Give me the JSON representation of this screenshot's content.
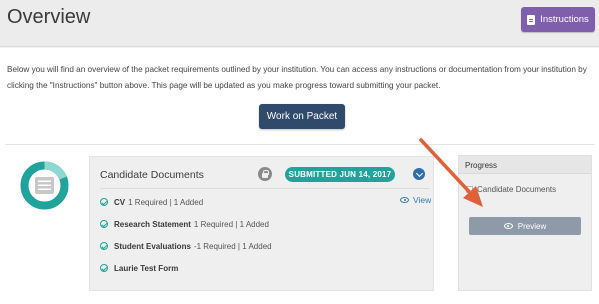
{
  "header": {
    "title": "Overview",
    "instructions_label": "Instructions"
  },
  "intro": {
    "text": "Below you will find an overview of the packet requirements outlined by your institution. You can access any instructions or documentation from your institution by clicking the \"Instructions\" button above. This page will be updated as you make progress toward submitting your packet."
  },
  "actions": {
    "work_label": "Work on Packet"
  },
  "section": {
    "title": "Candidate Documents",
    "badge": "SUBMITTED JUN 14, 2017",
    "view_label": "View",
    "items": [
      {
        "name": "CV",
        "meta": "1 Required | 1 Added"
      },
      {
        "name": "Research Statement",
        "meta": "1 Required | 1 Added"
      },
      {
        "name": "Student Evaluations",
        "meta": "-1 Required | 1 Added"
      },
      {
        "name": "Laurie Test Form",
        "meta": ""
      }
    ]
  },
  "progress": {
    "title": "Progress",
    "item": "Candidate Documents",
    "preview_label": "Preview"
  },
  "colors": {
    "accent_purple": "#7f5fab",
    "navy_button": "#2f4a6b",
    "teal": "#1fa39a",
    "arrow_orange": "#e0603a"
  }
}
